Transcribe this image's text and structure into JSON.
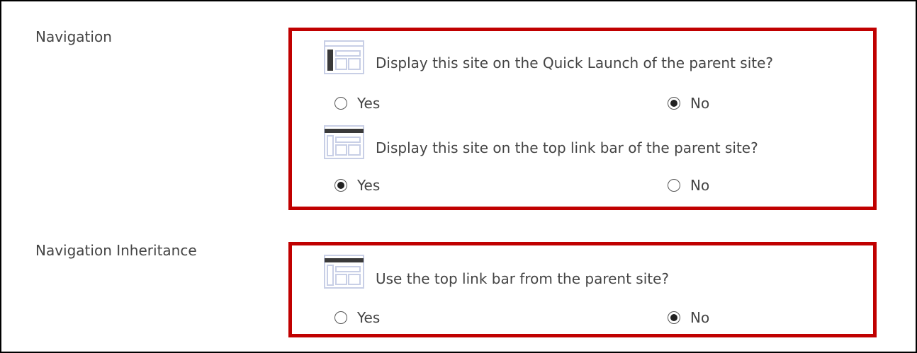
{
  "navigation": {
    "label": "Navigation",
    "quick_launch": {
      "icon": "quick-launch-layout-icon",
      "question": "Display this site on the Quick Launch of the parent site?",
      "options": [
        {
          "label": "Yes",
          "selected": false
        },
        {
          "label": "No",
          "selected": true
        }
      ]
    },
    "top_link_bar": {
      "icon": "top-link-bar-layout-icon",
      "question": "Display this site on the top link bar of the parent site?",
      "options": [
        {
          "label": "Yes",
          "selected": true
        },
        {
          "label": "No",
          "selected": false
        }
      ]
    }
  },
  "inheritance": {
    "label": "Navigation Inheritance",
    "use_parent": {
      "icon": "top-link-bar-layout-icon",
      "question": "Use the top link bar from the parent site?",
      "options": [
        {
          "label": "Yes",
          "selected": false
        },
        {
          "label": "No",
          "selected": true
        }
      ]
    }
  },
  "colors": {
    "highlight_border": "#c00000",
    "icon_stroke": "#c8cfe6",
    "icon_dark": "#3a3a3a"
  }
}
